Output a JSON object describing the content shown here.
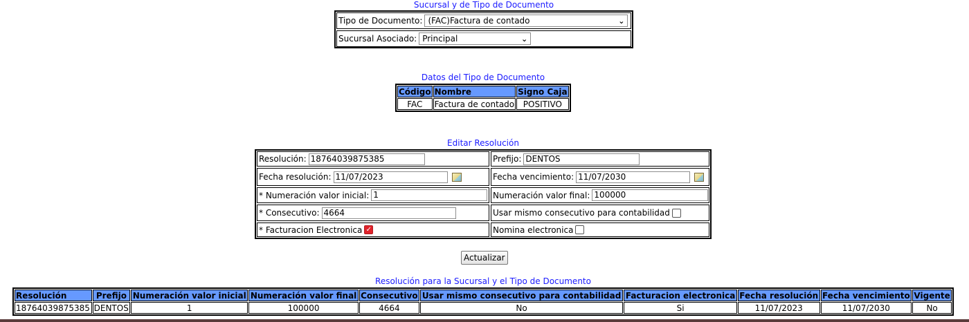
{
  "top_section": {
    "caption": "Sucursal y de Tipo de Documento",
    "tipo_label": "Tipo de Documento:",
    "tipo_value": "(FAC)Factura de contado",
    "sucursal_label": "Sucursal Asociado:",
    "sucursal_value": "Principal"
  },
  "datos_section": {
    "caption": "Datos del Tipo de Documento",
    "headers": [
      "Código",
      "Nombre",
      "Signo Caja"
    ],
    "row": [
      "FAC",
      "Factura de contado",
      "POSITIVO"
    ]
  },
  "editar_section": {
    "caption": "Editar Resolución",
    "resolucion_label": "Resolución:",
    "resolucion_value": "18764039875385",
    "prefijo_label": "Prefijo:",
    "prefijo_value": "DENTOS",
    "fecha_res_label": "Fecha resolución:",
    "fecha_res_value": "11/07/2023",
    "fecha_venc_label": "Fecha vencimiento:",
    "fecha_venc_value": "11/07/2030",
    "num_inicial_label": "* Numeración valor inicial:",
    "num_inicial_value": "1",
    "num_final_label": "Numeración valor final:",
    "num_final_value": "100000",
    "consecutivo_label": "* Consecutivo:",
    "consecutivo_value": "4664",
    "mismo_consec_label": "Usar mismo consecutivo para contabilidad",
    "mismo_consec_checked": false,
    "fact_elec_label": "* Facturacion Electronica",
    "fact_elec_checked": true,
    "nomina_label": "Nomina electronica",
    "nomina_checked": false
  },
  "actualizar_button": "Actualizar",
  "resoluciones_section": {
    "caption": "Resolución para la Sucursal y el Tipo de Documento",
    "headers": [
      "Resolución",
      "Prefijo",
      "Numeración valor inicial",
      "Numeración valor final",
      "Consecutivo",
      "Usar mismo consecutivo para contabilidad",
      "Facturacion electronica",
      "Fecha resolución",
      "Fecha vencimiento",
      "Vigente"
    ],
    "rows": [
      [
        "18764039875385",
        "DENTOS",
        "1",
        "100000",
        "4664",
        "No",
        "Si",
        "11/07/2023",
        "11/07/2030",
        "No"
      ]
    ]
  },
  "colors": {
    "caption": "#1a1aff",
    "header_bg": "#6699ff",
    "checkbox_checked": "#e0232b"
  }
}
